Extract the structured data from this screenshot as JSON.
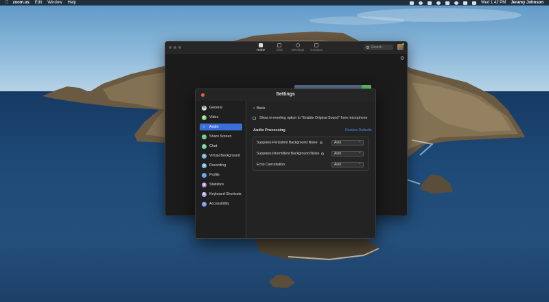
{
  "menubar": {
    "apple": "",
    "app": "zoom.us",
    "items": [
      "Edit",
      "Window",
      "Help"
    ],
    "clock": "Wed 1:42 PM",
    "user": "Jeramy Johnson"
  },
  "zoom": {
    "tabs": [
      {
        "label": "Home",
        "icon": "home-icon",
        "active": true
      },
      {
        "label": "Chat",
        "icon": "chat-icon",
        "active": false
      },
      {
        "label": "Meetings",
        "icon": "clock-icon",
        "active": false
      },
      {
        "label": "Contacts",
        "icon": "contacts-icon",
        "active": false
      }
    ],
    "search_placeholder": "Search"
  },
  "settings": {
    "title": "Settings",
    "sidebar": [
      {
        "label": "General",
        "icon": "general-icon",
        "color": "#e8e8e8",
        "active": false
      },
      {
        "label": "Video",
        "icon": "video-icon",
        "color": "#8ed58a",
        "active": false
      },
      {
        "label": "Audio",
        "icon": "headphones-icon",
        "color": "#ffffff",
        "active": true
      },
      {
        "label": "Share Screen",
        "icon": "share-screen-icon",
        "color": "#6ccf8a",
        "active": false
      },
      {
        "label": "Chat",
        "icon": "chat-icon",
        "color": "#7fd3a0",
        "active": false
      },
      {
        "label": "Virtual Background",
        "icon": "virtual-background-icon",
        "color": "#7fb8e8",
        "active": false
      },
      {
        "label": "Recording",
        "icon": "recording-icon",
        "color": "#76c4e8",
        "active": false
      },
      {
        "label": "Profile",
        "icon": "profile-icon",
        "color": "#6aa6e8",
        "active": false
      },
      {
        "label": "Statistics",
        "icon": "statistics-icon",
        "color": "#b58fe0",
        "active": false
      },
      {
        "label": "Keyboard Shortcuts",
        "icon": "keyboard-icon",
        "color": "#a89be8",
        "active": false
      },
      {
        "label": "Accessibility",
        "icon": "accessibility-icon",
        "color": "#7f9ee8",
        "active": false
      }
    ],
    "content": {
      "back": "Back",
      "original_sound_label": "Show in-meeting option to \"Enable Original Sound\" from microphone",
      "original_sound_checked": false,
      "audio_processing_title": "Audio Processing",
      "restore_defaults": "Restore Defaults",
      "processing": [
        {
          "label": "Suppress Persistent Background Noise",
          "help": true,
          "value": "Auto"
        },
        {
          "label": "Suppress Intermittent Background Noise",
          "help": true,
          "value": "Auto"
        },
        {
          "label": "Echo Cancellation",
          "help": false,
          "value": "Auto"
        }
      ]
    }
  }
}
